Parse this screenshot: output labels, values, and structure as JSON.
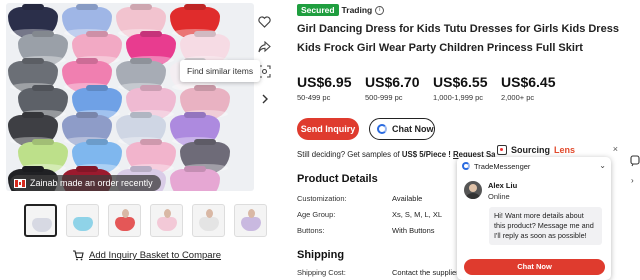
{
  "gallery": {
    "skirt_colors": [
      "#2b2f4a",
      "#9fb6e6",
      "#f2c3cf",
      "#e02c2c",
      "#9aa0a8",
      "#f2a9c4",
      "#e83c8f",
      "#f6dbe4",
      "#6b6f76",
      "#f07fb0",
      "#a7acb5",
      "#f4eef2",
      "#5d6168",
      "#6fa1e6",
      "#efbad2",
      "#e9b2c2",
      "#3e3f44",
      "#8e9cc8",
      "#cfd6e4",
      "#ad8adf",
      "#bde08a",
      "#7fb7ee",
      "#f2b4cc",
      "#6e6b78",
      "#202124",
      "#9b1a2e",
      "#d9cce7",
      "#e6a7d3"
    ],
    "toast_text": "Zainab made an order recently",
    "tooltip": "Find similar items",
    "thumb_colors": [
      "#d7d9e3",
      "#8fd3e8",
      "#e45757",
      "#f3c9d7",
      "#e4e4e4",
      "#c9b9e0"
    ]
  },
  "basket": {
    "label": "Add Inquiry Basket to Compare"
  },
  "product": {
    "secured_badge": "Secured",
    "secured_text": "Trading",
    "title": "Girl Dancing Dress for Kids Tutu Dresses for Girls Kids Dress Kids Frock Girl Wear Party Children Princess Full Skirt",
    "prices": [
      {
        "amount": "US$6.95",
        "qty": "50-499 pc"
      },
      {
        "amount": "US$6.70",
        "qty": "500-999 pc"
      },
      {
        "amount": "US$6.55",
        "qty": "1,000-1,999 pc"
      },
      {
        "amount": "US$6.45",
        "qty": "2,000+ pc"
      }
    ],
    "send_inquiry": "Send Inquiry",
    "chat_now": "Chat Now",
    "samples_prefix": "Still deciding? Get samples of",
    "samples_price": "US$ 5/Piece !",
    "samples_link": "Request Samp"
  },
  "details": {
    "heading": "Product Details",
    "rows": [
      {
        "label": "Customization:",
        "value": "Available"
      },
      {
        "label": "Age Group:",
        "value": "Xs, S, M, L, XL"
      },
      {
        "label": "Buttons:",
        "value": "With Buttons"
      }
    ]
  },
  "shipping": {
    "heading": "Shipping",
    "cost_label": "Shipping Cost:",
    "cost_value": "Contact the supplier"
  },
  "lens": {
    "title_main": "Sourcing",
    "title_accent": "Lens",
    "close": "×"
  },
  "messenger": {
    "app_name": "TradeMessenger",
    "agent_name": "Alex Liu",
    "agent_status": "Online",
    "message": "Hi! Want more details about this product? Message me and I'll reply as soon as possible!",
    "chat_button": "Chat Now"
  }
}
